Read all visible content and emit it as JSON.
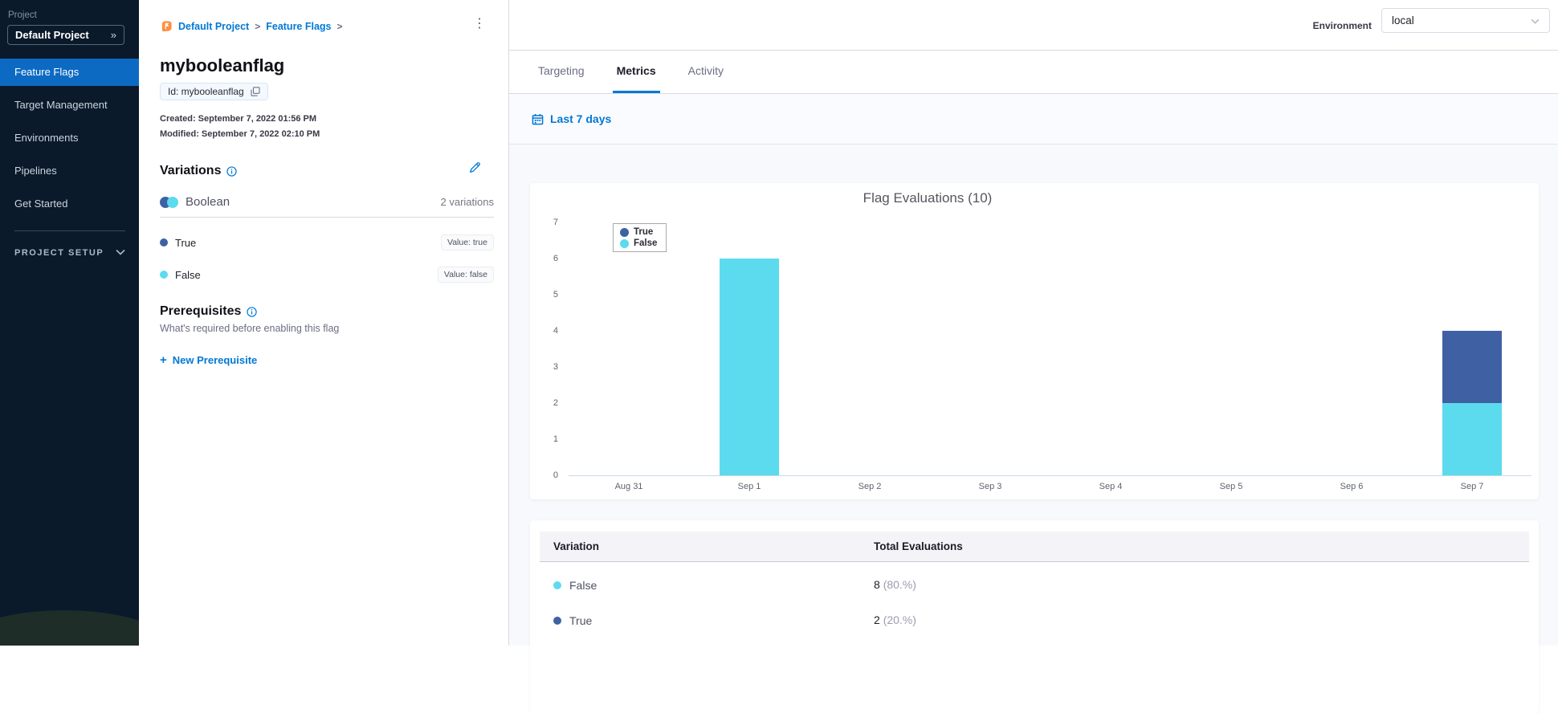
{
  "sidebar": {
    "project_label": "Project",
    "project_selector": "Default Project",
    "items": [
      {
        "label": "Feature Flags",
        "active": true
      },
      {
        "label": "Target Management",
        "active": false
      },
      {
        "label": "Environments",
        "active": false
      },
      {
        "label": "Pipelines",
        "active": false
      },
      {
        "label": "Get Started",
        "active": false
      }
    ],
    "section_label": "PROJECT SETUP"
  },
  "header": {
    "breadcrumb": [
      "Default Project",
      "Feature Flags"
    ],
    "environment_label": "Environment",
    "environment_value": "local"
  },
  "flag": {
    "name": "mybooleanflag",
    "id_chip": "Id: mybooleanflag",
    "created": "Created: September 7, 2022 01:56 PM",
    "modified": "Modified: September 7, 2022 02:10 PM"
  },
  "variations": {
    "title": "Variations",
    "type_label": "Boolean",
    "count_label": "2 variations",
    "items": [
      {
        "name": "True",
        "value_label": "Value: true",
        "color": "#3f61a4"
      },
      {
        "name": "False",
        "value_label": "Value: false",
        "color": "#5cdbee"
      }
    ]
  },
  "prerequisites": {
    "title": "Prerequisites",
    "subtitle": "What's required before enabling this flag",
    "new_button": "New Prerequisite"
  },
  "tabs": [
    {
      "label": "Targeting",
      "active": false
    },
    {
      "label": "Metrics",
      "active": true
    },
    {
      "label": "Activity",
      "active": false
    }
  ],
  "filter": {
    "label": "Last 7 days"
  },
  "chart_data": {
    "type": "bar",
    "stacked": true,
    "title": "Flag Evaluations (10)",
    "categories": [
      "Aug 31",
      "Sep 1",
      "Sep 2",
      "Sep 3",
      "Sep 4",
      "Sep 5",
      "Sep 6",
      "Sep 7"
    ],
    "series": [
      {
        "name": "True",
        "color": "#3f61a4",
        "values": [
          0,
          0,
          0,
          0,
          0,
          0,
          0,
          2
        ]
      },
      {
        "name": "False",
        "color": "#5cdbee",
        "values": [
          0,
          6,
          0,
          0,
          0,
          0,
          0,
          2
        ]
      }
    ],
    "xlabel": "",
    "ylabel": "",
    "ylim": [
      0,
      7
    ],
    "yticks": [
      0,
      1,
      2,
      3,
      4,
      5,
      6,
      7
    ],
    "legend_position": "top-left",
    "grid": false
  },
  "table": {
    "columns": [
      "Variation",
      "Total Evaluations"
    ],
    "rows": [
      {
        "variation": "False",
        "color": "#5cdbee",
        "total": "8",
        "pct": "(80.%)"
      },
      {
        "variation": "True",
        "color": "#3f61a4",
        "total": "2",
        "pct": "(20.%)"
      }
    ]
  },
  "icons": {
    "breadcrumb_separator": ">",
    "more_options": "⋮",
    "project_expand": "»",
    "plus": "+"
  },
  "colors": {
    "primary_blue": "#0278d5",
    "sidebar_bg": "#0a1a2b",
    "active_item_bg": "#0d6ac2",
    "true_series": "#3f61a4",
    "false_series": "#5cdbee"
  }
}
